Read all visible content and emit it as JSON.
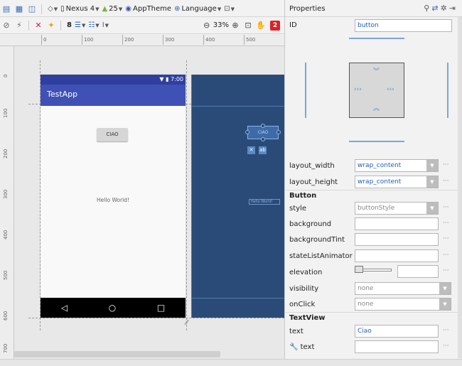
{
  "toolbar_top": {
    "device": "Nexus 4",
    "api": "25",
    "theme": "AppTheme",
    "language": "Language"
  },
  "toolbar_bottom": {
    "margin_value": "8",
    "zoom": "33%",
    "warnings_count": "2"
  },
  "ruler": {
    "h": [
      "0",
      "100",
      "200",
      "300",
      "400",
      "500"
    ],
    "v": [
      "0",
      "100",
      "200",
      "300",
      "400",
      "500",
      "600",
      "700"
    ]
  },
  "phone": {
    "time": "7:00",
    "app_title": "TestApp",
    "button_text": "CIAO",
    "hello_text": "Hello World!",
    "blueprint_button_text": "CIAO",
    "blueprint_hello_text": "Hello World!"
  },
  "properties": {
    "header": "Properties",
    "id_label": "ID",
    "id_value": "button",
    "layout_width_label": "layout_width",
    "layout_width_value": "wrap_content",
    "layout_height_label": "layout_height",
    "layout_height_value": "wrap_content",
    "section_button": "Button",
    "style_label": "style",
    "style_value": "buttonStyle",
    "background_label": "background",
    "background_tint_label": "backgroundTint",
    "state_list_animator_label": "stateListAnimator",
    "elevation_label": "elevation",
    "visibility_label": "visibility",
    "visibility_value": "none",
    "onclick_label": "onClick",
    "onclick_value": "none",
    "section_textview": "TextView",
    "text_label": "text",
    "text_value": "Ciao",
    "text_tools_label": "text"
  },
  "colors": {
    "app_bar": "#3f51b5",
    "status_bar": "#303f9f",
    "blueprint": "#2a4b77",
    "link_blue": "#1f5fbf"
  }
}
